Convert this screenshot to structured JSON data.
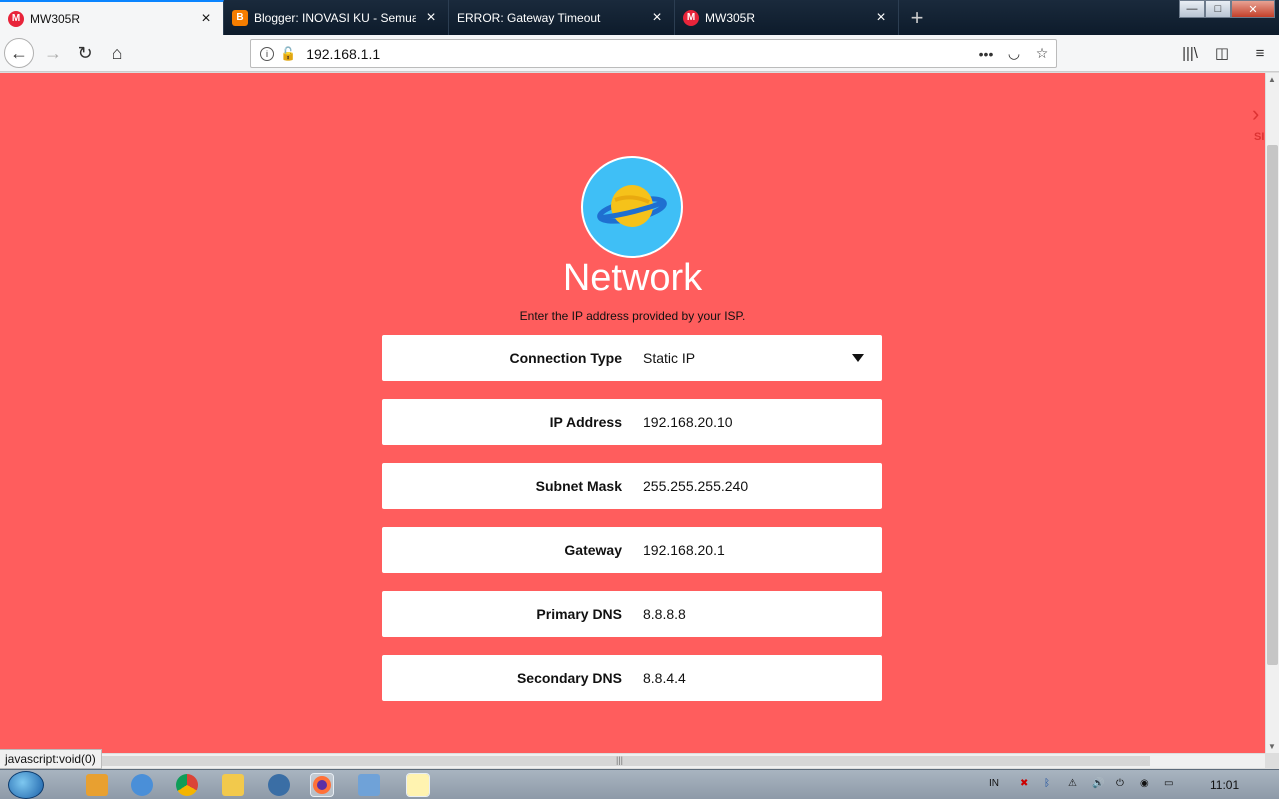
{
  "tabs": [
    {
      "label": "MW305R",
      "favicon": "m",
      "favicon_text": "M"
    },
    {
      "label": "Blogger: INOVASI KU - Semua p",
      "favicon": "b",
      "favicon_text": "B"
    },
    {
      "label": "ERROR: Gateway Timeout",
      "favicon": "none",
      "favicon_text": ""
    },
    {
      "label": "MW305R",
      "favicon": "m",
      "favicon_text": "M"
    }
  ],
  "window": {
    "minimize": "—",
    "maximize": "□",
    "close": "✕"
  },
  "address_bar": {
    "url": "192.168.1.1"
  },
  "page": {
    "title": "Network",
    "subtitle": "Enter the IP address provided by your ISP.",
    "side_label": "SI",
    "fields": [
      {
        "label": "Connection Type",
        "value": "Static IP"
      },
      {
        "label": "IP Address",
        "value": "192.168.20.10"
      },
      {
        "label": "Subnet Mask",
        "value": "255.255.255.240"
      },
      {
        "label": "Gateway",
        "value": "192.168.20.1"
      },
      {
        "label": "Primary DNS",
        "value": "8.8.8.8"
      },
      {
        "label": "Secondary DNS",
        "value": "8.8.4.4"
      }
    ]
  },
  "status_bar": {
    "text": "javascript:void(0)"
  },
  "taskbar": {
    "language": "IN",
    "clock": "11:01"
  },
  "colors": {
    "page_background": "#ff5d5d",
    "logo_circle": "#3fbff6",
    "planet": "#f6c21a",
    "ring": "#1f6fd0"
  }
}
